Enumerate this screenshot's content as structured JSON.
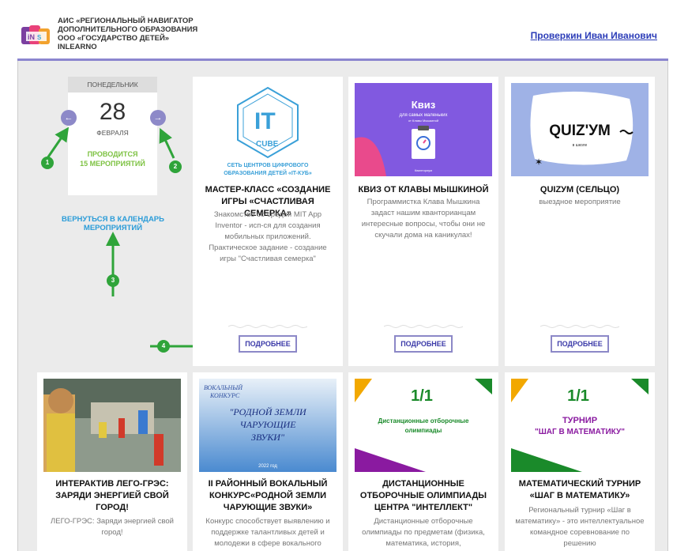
{
  "header": {
    "title_lines": [
      "АИС «РЕГИОНАЛЬНЫЙ НАВИГАТОР",
      "ДОПОЛНИТЕЛЬНОГО ОБРАЗОВАНИЯ",
      "ООО «ГОСУДАРСТВО ДЕТЕЙ»",
      "INLEARNO"
    ],
    "user_name": "Проверкин Иван Иванович"
  },
  "date_panel": {
    "weekday": "ПОНЕДЕЛЬНИК",
    "day": "28",
    "month": "ФЕВРАЛЯ",
    "events_line1": "ПРОВОДИТСЯ",
    "events_line2": "15 МЕРОПРИЯТИЙ",
    "prev_icon": "arrow-left-icon",
    "next_icon": "arrow-right-icon",
    "back_link": "ВЕРНУТЬСЯ В КАЛЕНДАРЬ МЕРОПРИЯТИЙ"
  },
  "annotations": [
    "1",
    "2",
    "3",
    "4"
  ],
  "cards": [
    {
      "title": "МАСТЕР-КЛАСС «СОЗДАНИЕ ИГРЫ «СЧАСТЛИВАЯ СЕМЕРКА»",
      "description": "Знакомство со средой MIT App Inventor - исп-ся для создания мобильных приложений. Практическое задание - создание игры \"Счастливая семерка\"",
      "image_caption_line1": "СЕТЬ ЦЕНТРОВ ЦИФРОВОГО",
      "image_caption_line2": "ОБРАЗОВАНИЯ ДЕТЕЙ «IT-КУБ»",
      "logo_letters": "IT",
      "logo_word": "CUBE",
      "button": "ПОДРОБНЕЕ"
    },
    {
      "title": "КВИЗ ОТ КЛАВЫ МЫШКИНОЙ",
      "description": "Программистка Клава Мышкина задаст нашим кванторианцам интересные вопросы, чтобы они не скучали дома на каникулах!",
      "image_heading": "Квиз",
      "image_sub": "для самых маленьких",
      "image_tiny": "от Клавы Мышкиной",
      "image_bottom": "Кванториум",
      "button": "ПОДРОБНЕЕ"
    },
    {
      "title": "QUIZУМ (СЕЛЬЦО)",
      "description": "выездное мероприятие",
      "image_logo": "QUIZ'УМ",
      "image_sub": "в школе",
      "button": "ПОДРОБНЕЕ"
    },
    {
      "title": "ИНТЕРАКТИВ ЛЕГО-ГРЭС: ЗАРЯДИ ЭНЕРГИЕЙ СВОЙ ГОРОД!",
      "description": "ЛЕГО-ГРЭС: Заряди энергией свой город!"
    },
    {
      "title": "II РАЙОННЫЙ ВОКАЛЬНЫЙ КОНКУРС«РОДНОЙ ЗЕМЛИ ЧАРУЮЩИЕ ЗВУКИ»",
      "description": "Конкурс способствует выявлению и поддержке талантливых детей и молодежи в сфере вокального",
      "image_text_1": "ВОКАЛЬНЫЙ",
      "image_text_2": "КОНКУРС",
      "image_text_3": "\"РОДНОЙ ЗЕМЛИ",
      "image_text_4": "ЧАРУЮЩИЕ",
      "image_text_5": "ЗВУКИ\"",
      "image_year": "2022 год"
    },
    {
      "title": "ДИСТАНЦИОННЫЕ ОТБОРОЧНЫЕ ОЛИМПИАДЫ ЦЕНТРА \"ИНТЕЛЛЕКТ\"",
      "description": "Дистанционные отборочные олимпиады по предметам (физика, математика, история,",
      "image_text_1": "Дистанционные отборочные",
      "image_text_2": "олимпиады"
    },
    {
      "title": "МАТЕМАТИЧЕСКИЙ ТУРНИР «ШАГ В МАТЕМАТИКУ»",
      "description": "Региональный турнир «Шаг в математику» - это интеллектуальное командное соревнование по решению",
      "image_text_1": "ТУРНИР",
      "image_text_2": "\"ШАГ В МАТЕМАТИКУ\""
    }
  ],
  "colors": {
    "accent": "#8b86cf",
    "link": "#2c3db8",
    "green": "#7dc242",
    "annotation_green": "#2fa43a"
  }
}
